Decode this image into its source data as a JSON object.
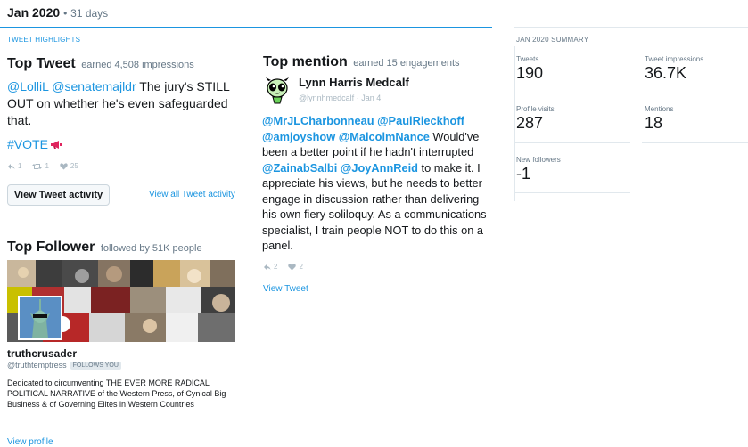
{
  "header": {
    "month": "Jan 2020",
    "separator": "•",
    "days": "31 days"
  },
  "highlights_label": "TWEET HIGHLIGHTS",
  "top_tweet": {
    "title": "Top Tweet",
    "subtitle": "earned 4,508 impressions",
    "mentions": "@LolliL @senatemajldr",
    "text": " The jury's STILL OUT on whether he's even safeguarded that.",
    "hashtag": "#VOTE",
    "hashtag_icon": "megaphone-icon",
    "retweet_icon": "retweet-icon",
    "like_icon": "heart-icon",
    "reply_icon": "reply-icon",
    "replies": "1",
    "retweets": "1",
    "likes": "25",
    "activity_button": "View Tweet activity",
    "view_all_link": "View all Tweet activity"
  },
  "top_follower": {
    "title": "Top Follower",
    "subtitle": "followed by 51K people",
    "name": "truthcrusader",
    "handle": "@truthtemptress",
    "follows_you": "FOLLOWS YOU",
    "bio": "Dedicated to circumventing THE EVER MORE RADICAL POLITICAL NARRATIVE of the Western Press, of Cynical Big Business & of Governing Elites in Western Countries",
    "view_profile": "View profile"
  },
  "top_mention": {
    "title": "Top mention",
    "subtitle": "earned 15 engagements",
    "name": "Lynn Harris Medcalf",
    "handle": "@lynnhmedcalf",
    "date": "Jan 4",
    "handles_1": "@MrJLCharbonneau @PaulRieckhoff @amjoyshow @MalcolmNance",
    "text_1": " Would've been a better point if he hadn't interrupted ",
    "handles_2": "@ZainabSalbi @JoyAnnReid",
    "text_2": " to make it. I appreciate his views, but he needs to better engage in discussion rather than delivering his own fiery soliloquy. As a communications specialist, I train people NOT to do this on a panel.",
    "replies": "2",
    "likes": "2",
    "view_tweet": "View Tweet"
  },
  "summary": {
    "label": "JAN 2020 SUMMARY",
    "metrics": [
      {
        "label": "Tweets",
        "value": "190"
      },
      {
        "label": "Tweet impressions",
        "value": "36.7K"
      },
      {
        "label": "Profile visits",
        "value": "287"
      },
      {
        "label": "Mentions",
        "value": "18"
      },
      {
        "label": "New followers",
        "value": "-1"
      }
    ]
  },
  "colors": {
    "accent": "#1b95e0",
    "text": "#14171a",
    "muted": "#657786"
  }
}
